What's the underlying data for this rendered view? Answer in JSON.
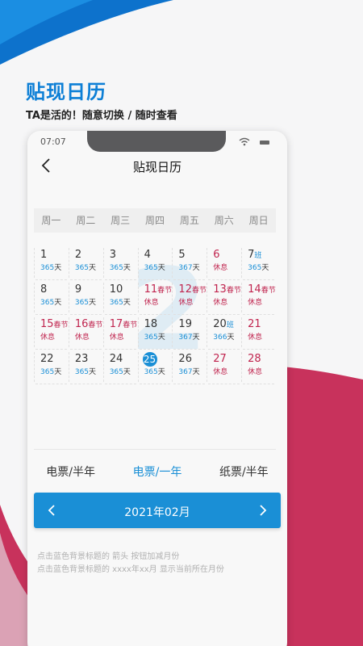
{
  "promo": {
    "title": "贴现日历",
    "subtitle": "TA是活的！随意切换 / 随时查看"
  },
  "colors": {
    "accent": "#1a8fd6",
    "rest": "#c0244e",
    "brand_pink": "#c8325c"
  },
  "status": {
    "time": "07:07"
  },
  "header": {
    "title": "贴现日历",
    "back_icon": "chevron-left-icon"
  },
  "weekdays": [
    "周一",
    "周二",
    "周三",
    "周四",
    "周五",
    "周六",
    "周日"
  ],
  "calendar": {
    "watermark": "2",
    "today": "25",
    "cells": [
      {
        "day": "1",
        "badge": "",
        "sub_num": "365",
        "sub_unit": "天"
      },
      {
        "day": "2",
        "badge": "",
        "sub_num": "365",
        "sub_unit": "天"
      },
      {
        "day": "3",
        "badge": "",
        "sub_num": "365",
        "sub_unit": "天"
      },
      {
        "day": "4",
        "badge": "",
        "sub_num": "365",
        "sub_unit": "天"
      },
      {
        "day": "5",
        "badge": "",
        "sub_num": "367",
        "sub_unit": "天"
      },
      {
        "day": "6",
        "badge": "",
        "rest": true,
        "sub_text": "休息"
      },
      {
        "day": "7",
        "badge": "班",
        "badge_type": "ban",
        "sub_num": "365",
        "sub_unit": "天"
      },
      {
        "day": "8",
        "badge": "",
        "sub_num": "365",
        "sub_unit": "天"
      },
      {
        "day": "9",
        "badge": "",
        "sub_num": "365",
        "sub_unit": "天"
      },
      {
        "day": "10",
        "badge": "",
        "sub_num": "365",
        "sub_unit": "天"
      },
      {
        "day": "11",
        "badge": "春节",
        "badge_type": "fest",
        "rest": true,
        "sub_text": "休息"
      },
      {
        "day": "12",
        "badge": "春节",
        "badge_type": "fest",
        "rest": true,
        "sub_text": "休息"
      },
      {
        "day": "13",
        "badge": "春节",
        "badge_type": "fest",
        "rest": true,
        "sub_text": "休息"
      },
      {
        "day": "14",
        "badge": "春节",
        "badge_type": "fest",
        "rest": true,
        "sub_text": "休息"
      },
      {
        "day": "15",
        "badge": "春节",
        "badge_type": "fest",
        "rest": true,
        "sub_text": "休息"
      },
      {
        "day": "16",
        "badge": "春节",
        "badge_type": "fest",
        "rest": true,
        "sub_text": "休息"
      },
      {
        "day": "17",
        "badge": "春节",
        "badge_type": "fest",
        "rest": true,
        "sub_text": "休息"
      },
      {
        "day": "18",
        "badge": "",
        "sub_num": "365",
        "sub_unit": "天"
      },
      {
        "day": "19",
        "badge": "",
        "sub_num": "367",
        "sub_unit": "天"
      },
      {
        "day": "20",
        "badge": "班",
        "badge_type": "ban",
        "sub_num": "366",
        "sub_unit": "天"
      },
      {
        "day": "21",
        "badge": "",
        "rest": true,
        "sub_text": "休息"
      },
      {
        "day": "22",
        "badge": "",
        "sub_num": "365",
        "sub_unit": "天"
      },
      {
        "day": "23",
        "badge": "",
        "sub_num": "365",
        "sub_unit": "天"
      },
      {
        "day": "24",
        "badge": "",
        "sub_num": "365",
        "sub_unit": "天"
      },
      {
        "day": "25",
        "badge": "",
        "today": true,
        "sub_num": "365",
        "sub_unit": "天"
      },
      {
        "day": "26",
        "badge": "",
        "sub_num": "367",
        "sub_unit": "天"
      },
      {
        "day": "27",
        "badge": "",
        "rest": true,
        "sub_text": "休息"
      },
      {
        "day": "28",
        "badge": "",
        "rest": true,
        "sub_text": "休息"
      }
    ]
  },
  "tabs": [
    {
      "label": "电票/半年",
      "active": false
    },
    {
      "label": "电票/一年",
      "active": true
    },
    {
      "label": "纸票/半年",
      "active": false
    }
  ],
  "month_bar": {
    "label": "2021年02月"
  },
  "hints": [
    "点击蓝色背景标题的 箭头 按钮加减月份",
    "点击蓝色背景标题的 xxxx年xx月 显示当前所在月份"
  ]
}
